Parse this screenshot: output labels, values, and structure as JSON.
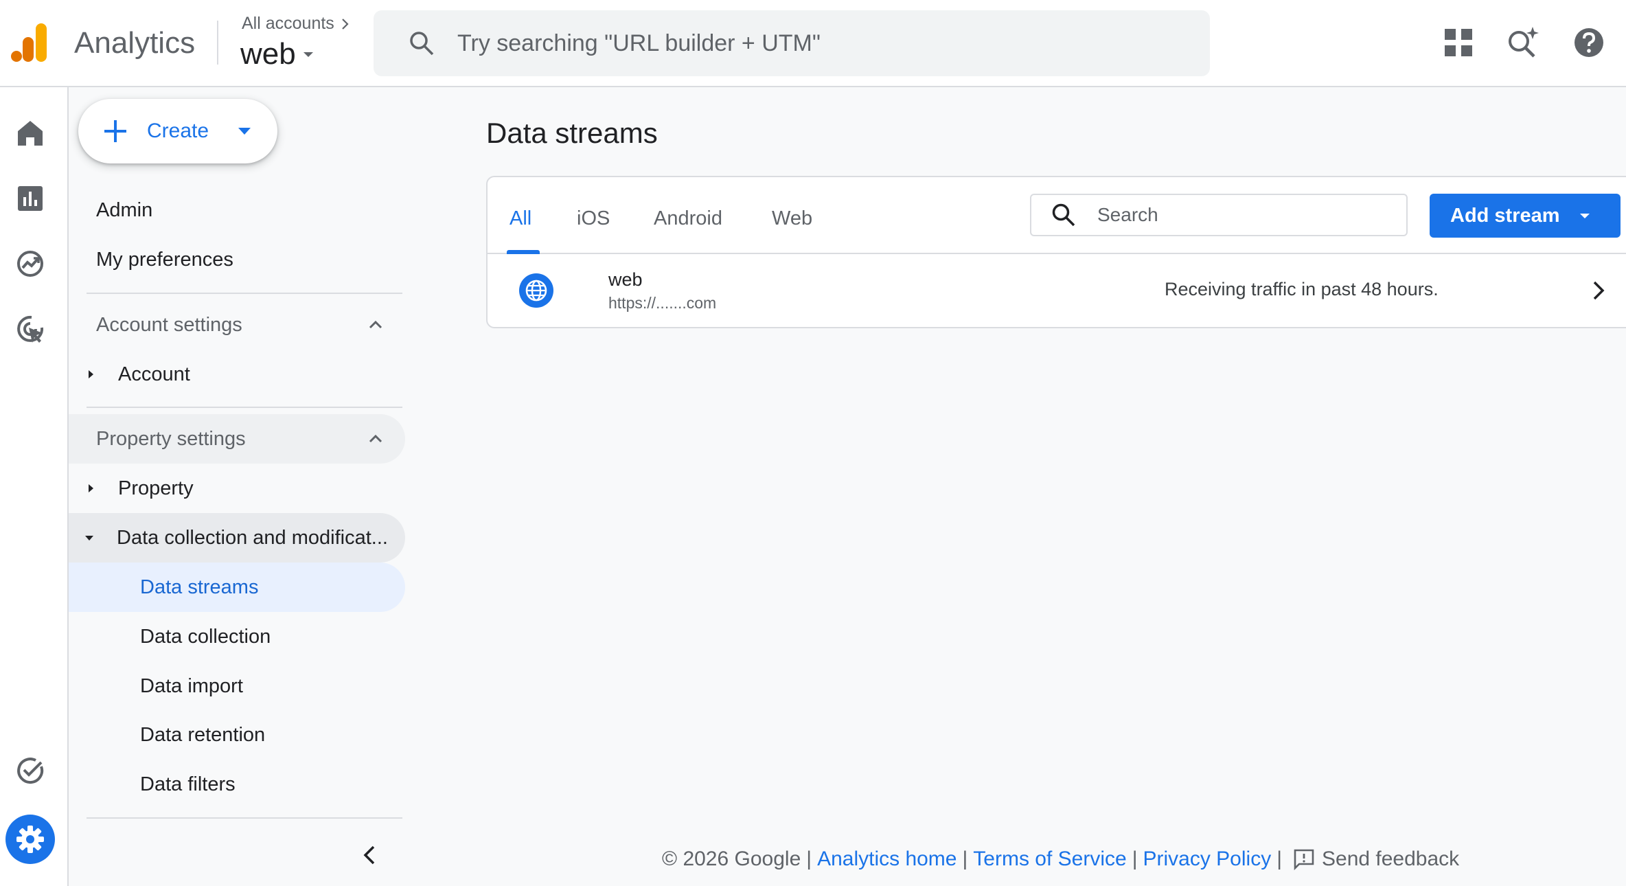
{
  "header": {
    "product_name": "Analytics",
    "breadcrumb": "All accounts",
    "property_name": "web",
    "search_placeholder": "Try searching \"URL builder + UTM\""
  },
  "create_button": {
    "label": "Create"
  },
  "nav": {
    "admin": "Admin",
    "my_preferences": "My preferences",
    "account_settings": "Account settings",
    "account": "Account",
    "property_settings": "Property settings",
    "property": "Property",
    "data_collection_modification": "Data collection and modificat...",
    "data_streams": "Data streams",
    "data_collection": "Data collection",
    "data_import": "Data import",
    "data_retention": "Data retention",
    "data_filters": "Data filters"
  },
  "main": {
    "title": "Data streams",
    "tabs": [
      {
        "label": "All",
        "active": true
      },
      {
        "label": "iOS",
        "active": false
      },
      {
        "label": "Android",
        "active": false
      },
      {
        "label": "Web",
        "active": false
      }
    ],
    "search_placeholder": "Search",
    "add_stream_label": "Add stream",
    "streams": [
      {
        "name": "web",
        "url": "https://.......com",
        "status": "Receiving traffic in past 48 hours.",
        "icon": "globe-icon"
      }
    ]
  },
  "footer": {
    "copyright": "© 2026 Google",
    "analytics_home": "Analytics home",
    "terms": "Terms of Service",
    "privacy": "Privacy Policy",
    "send_feedback": "Send feedback"
  },
  "colors": {
    "accent": "#1a73e8",
    "logo_orange": "#f9ab00",
    "logo_dark_orange": "#e37400",
    "nav_active_bg": "#e8f0fe",
    "background": "#f8f9fa"
  }
}
